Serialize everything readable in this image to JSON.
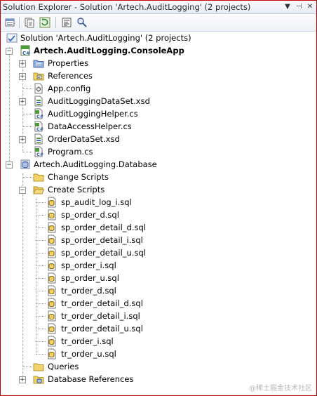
{
  "window": {
    "title": "Solution Explorer - Solution 'Artech.AuditLogging' (2 projects)",
    "dropdown_glyph": "▼",
    "pin_glyph": "⊣",
    "close_glyph": "✕"
  },
  "toolbar": {
    "icons": [
      "properties-icon",
      "show-all-files-icon",
      "refresh-icon",
      "view-code-icon",
      "class-view-icon"
    ]
  },
  "tree": {
    "solution_label": "Solution 'Artech.AuditLogging' (2 projects)",
    "console_app": {
      "label": "Artech.AuditLogging.ConsoleApp",
      "items": [
        {
          "label": "Properties",
          "icon": "properties-folder-icon",
          "expander": "+"
        },
        {
          "label": "References",
          "icon": "references-icon",
          "expander": "+"
        },
        {
          "label": "App.config",
          "icon": "config-file-icon",
          "expander": ""
        },
        {
          "label": "AuditLoggingDataSet.xsd",
          "icon": "xsd-file-icon",
          "expander": "+"
        },
        {
          "label": "AuditLoggingHelper.cs",
          "icon": "csharp-file-icon",
          "expander": ""
        },
        {
          "label": "DataAccessHelper.cs",
          "icon": "csharp-file-icon",
          "expander": ""
        },
        {
          "label": "OrderDataSet.xsd",
          "icon": "xsd-file-icon",
          "expander": "+"
        },
        {
          "label": "Program.cs",
          "icon": "csharp-file-icon",
          "expander": ""
        }
      ]
    },
    "database": {
      "label": "Artech.AuditLogging.Database",
      "change_scripts": "Change Scripts",
      "create_scripts": "Create Scripts",
      "scripts": [
        "sp_audit_log_i.sql",
        "sp_order_d.sql",
        "sp_order_detail_d.sql",
        "sp_order_detail_i.sql",
        "sp_order_detail_u.sql",
        "sp_order_i.sql",
        "sp_order_u.sql",
        "tr_order_d.sql",
        "tr_order_detail_d.sql",
        "tr_order_detail_i.sql",
        "tr_order_detail_u.sql",
        "tr_order_i.sql",
        "tr_order_u.sql"
      ],
      "queries": "Queries",
      "database_references": "Database References"
    }
  },
  "watermark": "@稀土掘金技术社区",
  "colors": {
    "folder": "#f2d36b",
    "frame_border": "#c00000",
    "accent_blue": "#3a6fc4"
  }
}
